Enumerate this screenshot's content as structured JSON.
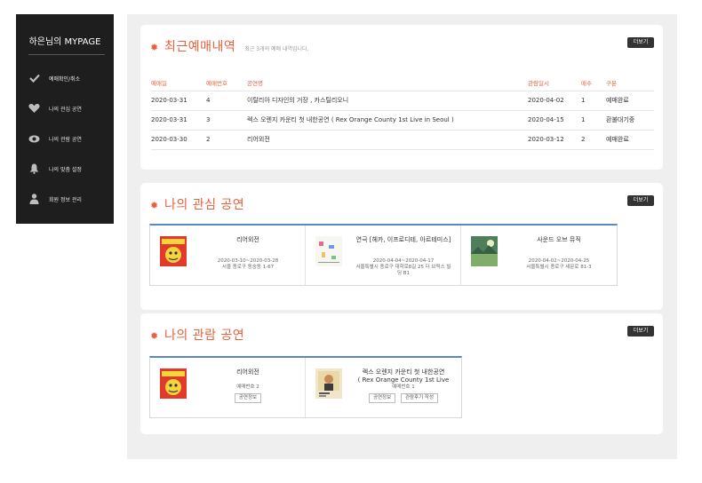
{
  "sidebar": {
    "title": "하은님의 MYPAGE",
    "items": [
      {
        "label": "예매확인/취소",
        "icon": "check-icon"
      },
      {
        "label": "나의 관심 공연",
        "icon": "heart-icon"
      },
      {
        "label": "나의 관람 공연",
        "icon": "eye-icon"
      },
      {
        "label": "나의 맞춤 설정",
        "icon": "bell-icon"
      },
      {
        "label": "회원 정보 관리",
        "icon": "user-icon"
      }
    ]
  },
  "recent": {
    "title": "최근예매내역",
    "subtitle": "최근 3개의 예매 내역입니다.",
    "more": "더보기",
    "headers": [
      "예매일",
      "예매번호",
      "공연명",
      "관람일시",
      "매수",
      "구분"
    ],
    "rows": [
      [
        "2020-03-31",
        "4",
        "이탈리아 디자인의 거장 , 카스틸리오니",
        "2020-04-02",
        "1",
        "예매완료"
      ],
      [
        "2020-03-31",
        "3",
        "렉스 오렌지 카운티 첫 내한공연 ( Rex Orange County 1st Live in Seoul )",
        "2020-04-15",
        "1",
        "환불대기중"
      ],
      [
        "2020-03-30",
        "2",
        "리어외전",
        "2020-03-12",
        "2",
        "예매완료"
      ]
    ]
  },
  "interest": {
    "title": "나의 관심 공연",
    "more": "더보기",
    "items": [
      {
        "title": "리어외전",
        "date": "2020-03-10~2020-03-28",
        "place": "서울 종로구 동숭동 1-67"
      },
      {
        "title": "연극 [헤카, 이프로디테, 아르테미스]",
        "date": "2020-04-04~2020-04-17",
        "place": "서울특별시 종로구 대학로8길 25 더 브릭스 빌딩 B1"
      },
      {
        "title": "사운드 오브 뮤직",
        "date": "2020-04-02~2020-04-25",
        "place": "서울특별시 종로구 새문로 81-3"
      }
    ]
  },
  "watched": {
    "title": "나의 관람 공연",
    "more": "더보기",
    "items": [
      {
        "title": "리어외전",
        "booking": "예매번호 2",
        "buttons": [
          "공연정보"
        ]
      },
      {
        "title": "렉스 오렌지 카운티 첫 내한공연 ( Rex Orange County 1st Live in Seoul )",
        "title_line1": "렉스 오렌지 카운티 첫 내한공연",
        "title_line2": "( Rex Orange County 1st Live",
        "booking": "예매번호 1",
        "buttons": [
          "공연정보",
          "관람후기 작성"
        ]
      }
    ]
  },
  "colors": {
    "accent": "#e8603c",
    "sidebar_bg": "#1e1e1e",
    "box_border": "#5b87c4"
  }
}
